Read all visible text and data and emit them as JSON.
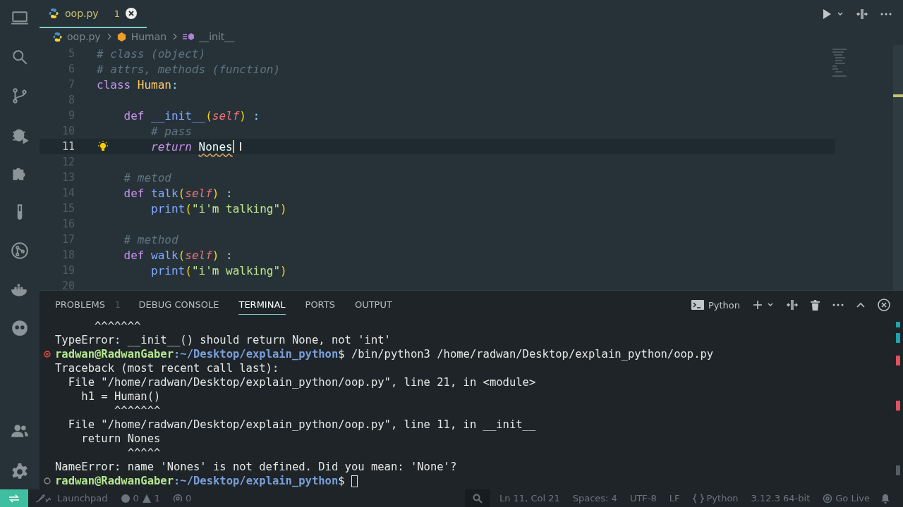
{
  "tab": {
    "filename": "oop.py",
    "problems": "1",
    "selected": true
  },
  "breadcrumbs": [
    "oop.py",
    "Human",
    "__init__"
  ],
  "code_lines": [
    {
      "number": "5",
      "current": false,
      "lightbulb": false,
      "tokens": [
        {
          "text": "# class (object)",
          "kind": "comment"
        }
      ]
    },
    {
      "number": "6",
      "current": false,
      "lightbulb": false,
      "tokens": [
        {
          "text": "# attrs, methods (function)",
          "kind": "comment"
        }
      ]
    },
    {
      "number": "7",
      "current": false,
      "lightbulb": false,
      "tokens": [
        {
          "text": "class",
          "kind": "keyword"
        },
        {
          "text": " Human",
          "kind": "class"
        },
        {
          "text": ":",
          "kind": "punct"
        }
      ]
    },
    {
      "number": "8",
      "current": false,
      "lightbulb": false
    },
    {
      "number": "9",
      "current": false,
      "lightbulb": false,
      "tokens": [
        {
          "text": "    def",
          "kind": "keyword"
        },
        {
          "text": " __init__",
          "kind": "func"
        },
        {
          "text": "(",
          "kind": "paren"
        },
        {
          "text": "self",
          "kind": "param"
        },
        {
          "text": ")",
          "kind": "paren"
        },
        {
          "text": " :",
          "kind": "punct"
        }
      ]
    },
    {
      "number": "10",
      "current": false,
      "lightbulb": false,
      "tokens": [
        {
          "text": "        # pass",
          "kind": "comment"
        }
      ]
    },
    {
      "number": "11",
      "current": true,
      "lightbulb": true,
      "tokens": [
        {
          "text": "        return ",
          "kind": "keyword-italic"
        },
        {
          "text": "Nones",
          "kind": "undefined"
        }
      ]
    },
    {
      "number": "12",
      "current": false,
      "lightbulb": false
    },
    {
      "number": "13",
      "current": false,
      "lightbulb": false,
      "tokens": [
        {
          "text": "    # metod",
          "kind": "comment"
        }
      ]
    },
    {
      "number": "14",
      "current": false,
      "lightbulb": false,
      "tokens": [
        {
          "text": "    def",
          "kind": "keyword"
        },
        {
          "text": " talk",
          "kind": "func"
        },
        {
          "text": "(",
          "kind": "paren"
        },
        {
          "text": "self",
          "kind": "param"
        },
        {
          "text": ")",
          "kind": "paren"
        },
        {
          "text": " :",
          "kind": "punct"
        }
      ]
    },
    {
      "number": "15",
      "current": false,
      "lightbulb": false,
      "tokens": [
        {
          "text": "        print",
          "kind": "func"
        },
        {
          "text": "(",
          "kind": "paren"
        },
        {
          "text": "\"i'm talking\"",
          "kind": "string"
        },
        {
          "text": ")",
          "kind": "paren"
        }
      ]
    },
    {
      "number": "16",
      "current": false,
      "lightbulb": false
    },
    {
      "number": "17",
      "current": false,
      "lightbulb": false,
      "tokens": [
        {
          "text": "    # method",
          "kind": "comment"
        }
      ]
    },
    {
      "number": "18",
      "current": false,
      "lightbulb": false,
      "tokens": [
        {
          "text": "    def",
          "kind": "keyword"
        },
        {
          "text": " walk",
          "kind": "func"
        },
        {
          "text": "(",
          "kind": "paren"
        },
        {
          "text": "self",
          "kind": "param"
        },
        {
          "text": ")",
          "kind": "paren"
        },
        {
          "text": " :",
          "kind": "punct"
        }
      ]
    },
    {
      "number": "19",
      "current": false,
      "lightbulb": false,
      "tokens": [
        {
          "text": "        print",
          "kind": "func"
        },
        {
          "text": "(",
          "kind": "paren"
        },
        {
          "text": "\"i'm walking\"",
          "kind": "string"
        },
        {
          "text": ")",
          "kind": "paren"
        }
      ]
    },
    {
      "number": "20",
      "current": false,
      "lightbulb": false
    }
  ],
  "panel": {
    "tabs": [
      {
        "label": "PROBLEMS",
        "badge": "1",
        "selected": false
      },
      {
        "label": "DEBUG CONSOLE",
        "selected": false
      },
      {
        "label": "TERMINAL",
        "selected": true
      },
      {
        "label": "PORTS",
        "selected": false
      },
      {
        "label": "OUTPUT",
        "selected": false
      }
    ],
    "shell": "Python"
  },
  "terminal_lines": [
    {
      "kind": "output",
      "text": "      ^^^^^^^"
    },
    {
      "kind": "output",
      "text": "TypeError: __init__() should return None, not 'int'"
    },
    {
      "kind": "prompt",
      "failed": true,
      "user": "radwan@RadwanGaber",
      "path": ":~/Desktop/explain_python",
      "command": "$ /bin/python3 /home/radwan/Desktop/explain_python/oop.py",
      "cursor": false
    },
    {
      "kind": "output",
      "text": "Traceback (most recent call last):"
    },
    {
      "kind": "output",
      "text": "  File \"/home/radwan/Desktop/explain_python/oop.py\", line 21, in <module>"
    },
    {
      "kind": "output",
      "text": "    h1 = Human()"
    },
    {
      "kind": "output",
      "text": "         ^^^^^^^"
    },
    {
      "kind": "output",
      "text": "  File \"/home/radwan/Desktop/explain_python/oop.py\", line 11, in __init__"
    },
    {
      "kind": "output",
      "text": "    return Nones"
    },
    {
      "kind": "output",
      "text": "           ^^^^^"
    },
    {
      "kind": "output",
      "text": "NameError: name 'Nones' is not defined. Did you mean: 'None'?"
    },
    {
      "kind": "prompt",
      "failed": false,
      "user": "radwan@RadwanGaber",
      "path": ":~/Desktop/explain_python",
      "command": "$",
      "cursor": true
    }
  ],
  "status_bar": {
    "launchpad": "Launchpad",
    "errors": "0",
    "warnings": "1",
    "ports": "0",
    "position": "Ln 11, Col 21",
    "spaces": "Spaces: 4",
    "encoding": "UTF-8",
    "eol": "LF",
    "language": "Python",
    "interpreter": "3.12.3 64-bit",
    "live": "Go Live"
  }
}
